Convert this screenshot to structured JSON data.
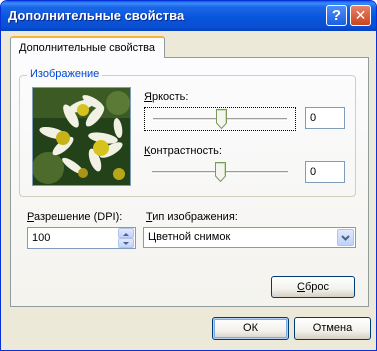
{
  "window": {
    "title": "Дополнительные свойства",
    "help_glyph": "?",
    "close_glyph": "✕"
  },
  "tab": {
    "label": "Дополнительные свойства"
  },
  "image_group": {
    "legend": "Изображение"
  },
  "brightness": {
    "label_accel": "Я",
    "label_rest": "ркость:",
    "value": "0"
  },
  "contrast": {
    "label_accel": "К",
    "label_rest": "онтрастность:",
    "value": "0"
  },
  "resolution": {
    "label_accel": "Р",
    "label_rest": "азрешение (DPI):",
    "value": "100"
  },
  "image_type": {
    "label_accel": "Т",
    "label_rest": "ип изображения:",
    "selected": "Цветной снимок"
  },
  "reset_button": {
    "label_accel": "С",
    "label_rest": "брос"
  },
  "ok_button": {
    "label": "ОК"
  },
  "cancel_button": {
    "label": "Отмена"
  },
  "colors": {
    "title_bar": "#0a4fd3",
    "dialog_bg": "#ece9d8",
    "group_legend": "#0046d5",
    "tab_highlight": "#f5b43c"
  },
  "icons": {
    "help": "help-icon",
    "close": "close-icon",
    "spin_up": "arrow-up-icon",
    "spin_down": "arrow-down-icon",
    "combo": "chevron-down-icon"
  }
}
